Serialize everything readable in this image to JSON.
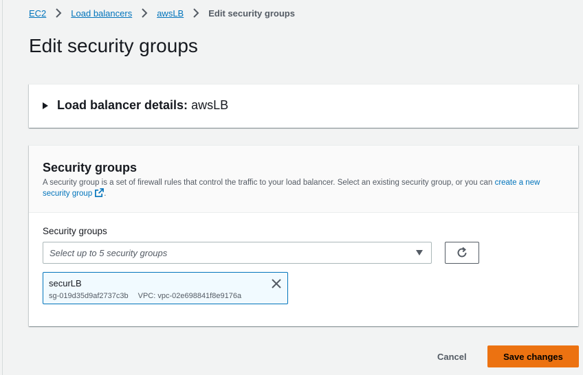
{
  "breadcrumb": {
    "items": [
      {
        "label": "EC2"
      },
      {
        "label": "Load balancers"
      },
      {
        "label": "awsLB"
      },
      {
        "label": "Edit security groups"
      }
    ]
  },
  "page": {
    "title": "Edit security groups"
  },
  "details_panel": {
    "label": "Load balancer details:",
    "value": "awsLB",
    "expanded": false
  },
  "security_groups_panel": {
    "title": "Security groups",
    "description_text": "A security group is a set of firewall rules that control the traffic to your load balancer. Select an existing security group, or you can",
    "create_link": "create a new security group",
    "description_end": ".",
    "field_label": "Security groups",
    "select_placeholder": "Select up to 5 security groups",
    "selected": [
      {
        "name": "securLB",
        "id": "sg-019d35d9af2737c3b",
        "vpc": "VPC: vpc-02e698841f8e9176a"
      }
    ]
  },
  "actions": {
    "cancel_label": "Cancel",
    "save_label": "Save changes"
  },
  "colors": {
    "link": "#0073bb",
    "primary_button": "#ec7211",
    "token_border": "#0073bb",
    "background": "#f2f3f3"
  },
  "icons": [
    "chevron-right-icon",
    "caret-right-icon",
    "external-link-icon",
    "caret-down-icon",
    "refresh-icon",
    "close-icon"
  ]
}
